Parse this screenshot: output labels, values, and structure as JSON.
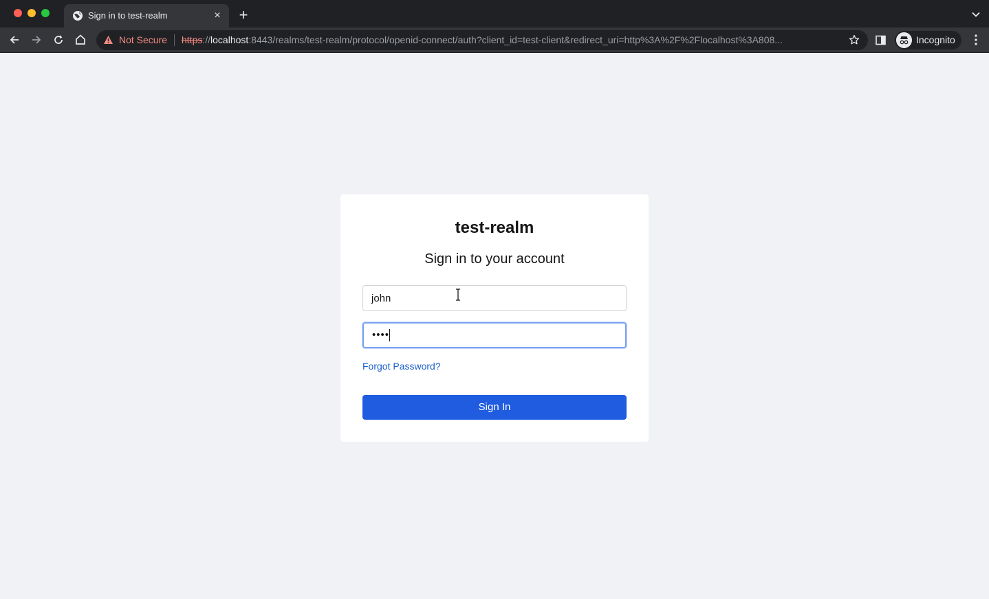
{
  "browser": {
    "tab": {
      "title": "Sign in to test-realm"
    },
    "omnibox": {
      "security_label": "Not Secure",
      "url_scheme": "https",
      "url_scheme_sep": "://",
      "url_host": "localhost",
      "url_rest": ":8443/realms/test-realm/protocol/openid-connect/auth?client_id=test-client&redirect_uri=http%3A%2F%2Flocalhost%3A808..."
    },
    "profile": {
      "label": "Incognito"
    },
    "icons": [
      "globe-icon",
      "close-icon",
      "plus-icon",
      "chevron-down-icon",
      "back-icon",
      "forward-icon",
      "reload-icon",
      "home-icon",
      "warning-icon",
      "star-icon",
      "side-panel-icon",
      "incognito-icon",
      "more-icon"
    ]
  },
  "login": {
    "realm_title": "test-realm",
    "heading": "Sign in to your account",
    "username_value": "john",
    "password_masked": "••••",
    "forgot_password": "Forgot Password?",
    "submit_label": "Sign In"
  },
  "colors": {
    "page_background": "#f0f2f5",
    "primary_button": "#1f5ce0",
    "link": "#1a5fcc",
    "focus_ring": "#7ca3f0",
    "warning": "#f28b82"
  }
}
